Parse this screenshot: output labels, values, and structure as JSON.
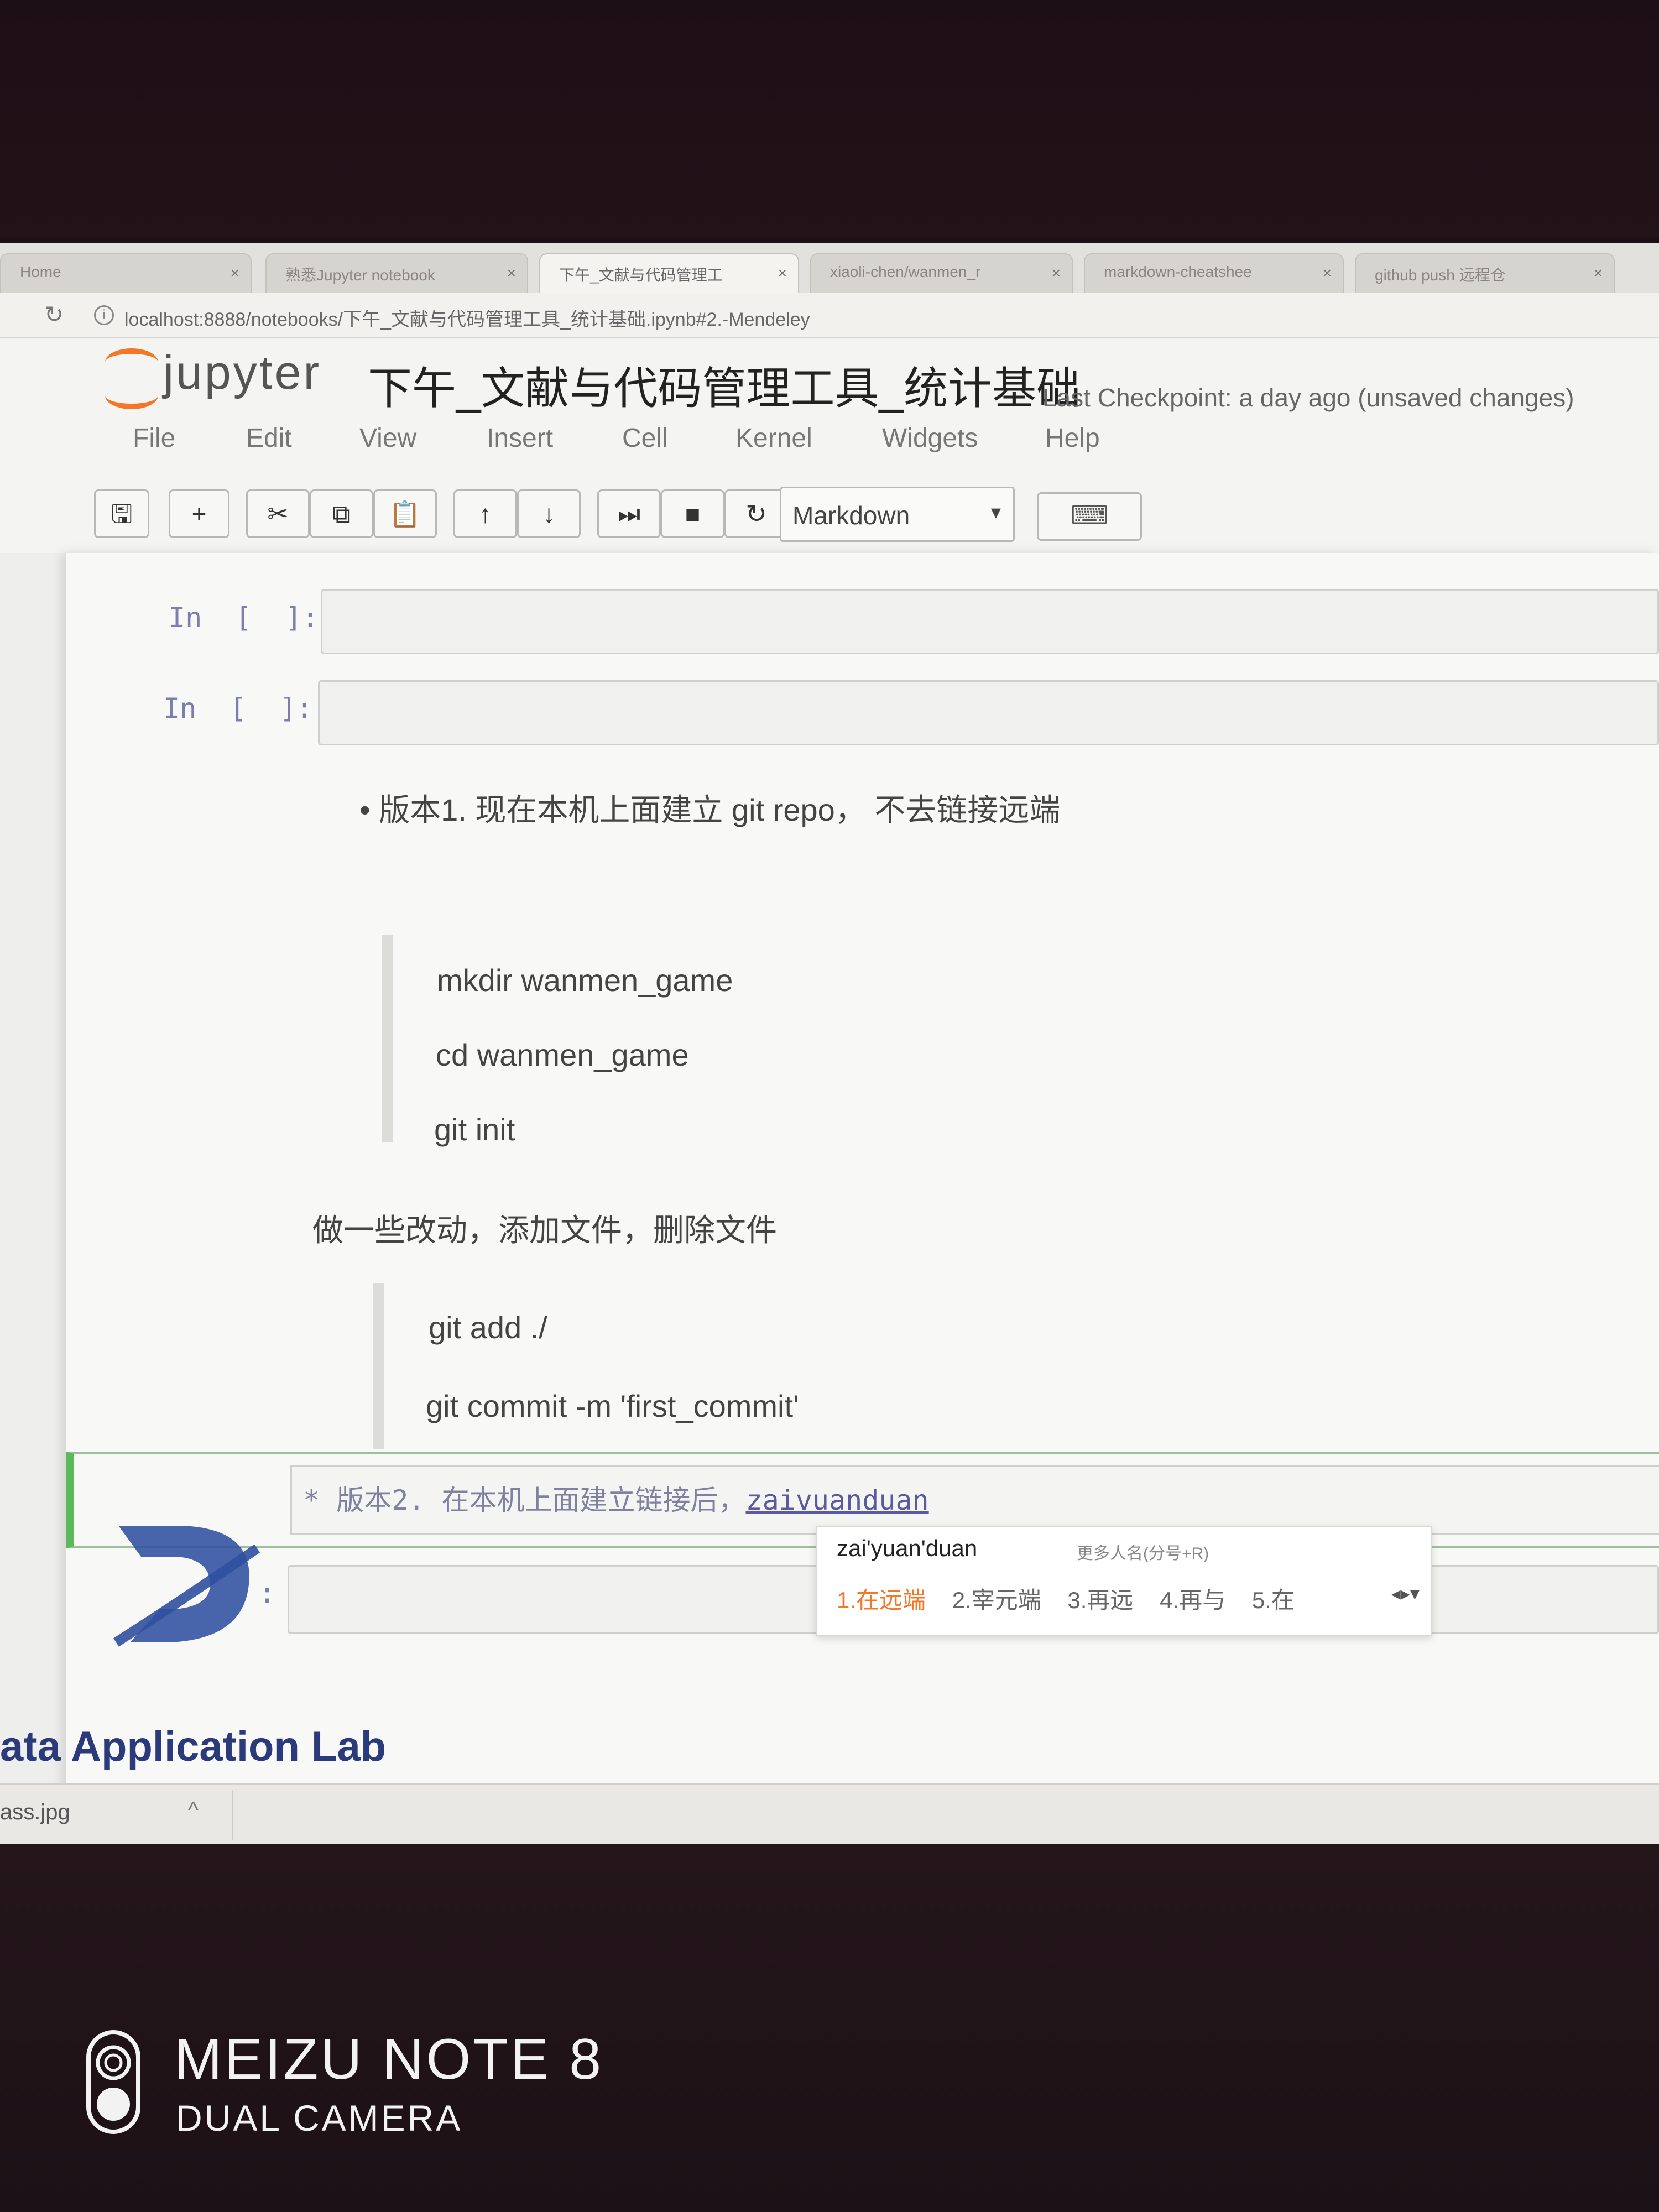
{
  "browser": {
    "tabs": [
      {
        "label": "Home"
      },
      {
        "label": "熟悉Jupyter notebook"
      },
      {
        "label": "下午_文献与代码管理工"
      },
      {
        "label": "xiaoli-chen/wanmen_r"
      },
      {
        "label": "markdown-cheatshee"
      },
      {
        "label": "github push 远程仓"
      }
    ],
    "url": "localhost:8888/notebooks/下午_文献与代码管理工具_统计基础.ipynb#2.-Mendeley"
  },
  "jupyter": {
    "logo_text": "jupyter",
    "notebook_title": "下午_文献与代码管理工具_统计基础",
    "checkpoint": "Last Checkpoint: a day ago (unsaved changes)",
    "menu": [
      "File",
      "Edit",
      "View",
      "Insert",
      "Cell",
      "Kernel",
      "Widgets",
      "Help"
    ],
    "cell_type": "Markdown"
  },
  "cells": {
    "prompt": "In  [  ]:",
    "bullet1": "版本1. 现在本机上面建立 git repo， 不去链接远端",
    "block1": [
      "mkdir wanmen_game",
      "cd wanmen_game",
      "git init"
    ],
    "para": "做一些改动，添加文件，删除文件",
    "block2": [
      "git add ./",
      "git commit -m 'first_commit'"
    ],
    "editing_prefix": "* 版本2. 在本机上面建立链接后，",
    "editing_typed": "zaivuanduan",
    "prompt_partial": ":"
  },
  "ime": {
    "composition": "zai'yuan'duan",
    "hint": "更多人名(分号+R)",
    "candidates": [
      "1.在远端",
      "2.宰元端",
      "3.再远",
      "4.再与",
      "5.在"
    ]
  },
  "watermark": {
    "text": "ata Application Lab"
  },
  "download": {
    "filename": "ass.jpg"
  },
  "camera": {
    "brand": "MEIZU NOTE 8",
    "sub": "DUAL CAMERA"
  }
}
